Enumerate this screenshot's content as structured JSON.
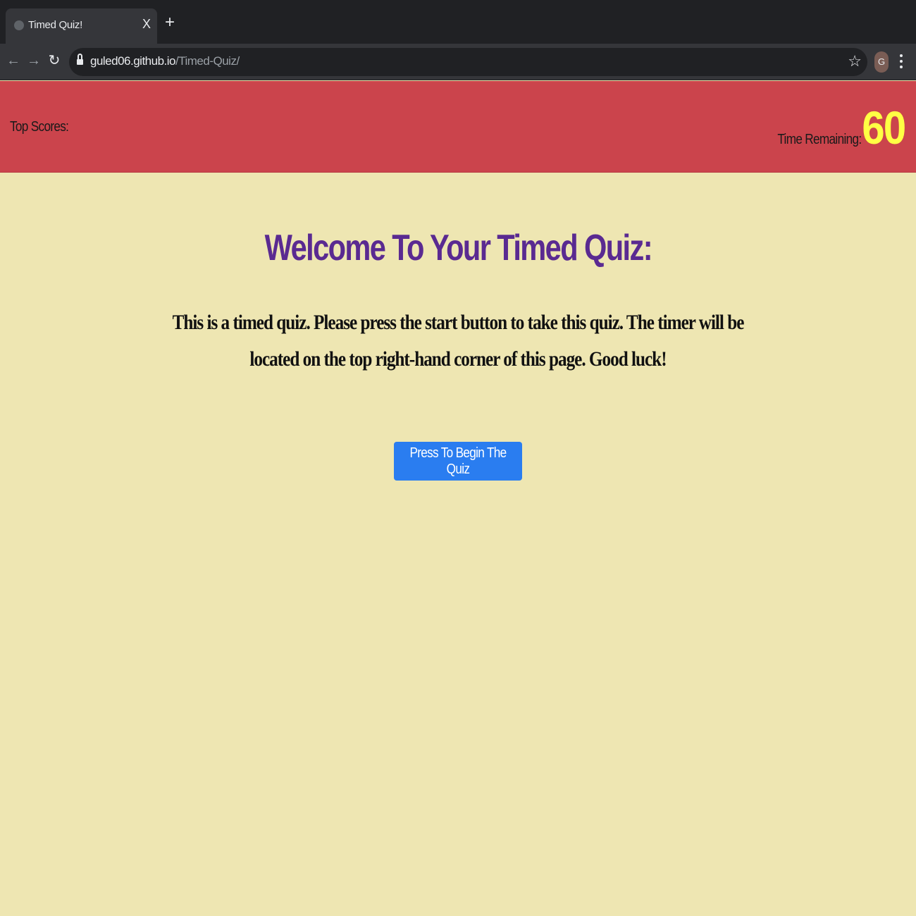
{
  "browser": {
    "tab_title": "Timed Quiz!",
    "tab_close": "X",
    "new_tab": "+",
    "url_host": "guled06.github.io",
    "url_path": "/Timed-Quiz/",
    "avatar_letter": "G",
    "icons": [
      "back-icon",
      "forward-icon",
      "reload-icon",
      "lock-icon",
      "star-icon",
      "menu-icon"
    ]
  },
  "header": {
    "top_scores_label": "Top Scores:",
    "time_label": "Time Remaining:",
    "time_value": "60"
  },
  "main": {
    "title": "Welcome To Your Timed Quiz:",
    "intro": "This is a timed quiz. Please press the start button to take this quiz. The timer will be located on the top right-hand corner of this page. Good luck!",
    "start_button": "Press To Begin The Quiz"
  },
  "colors": {
    "header_bg": "#CB444C",
    "page_bg": "#EEE6B2",
    "title": "#5A2A91",
    "timer": "#FFFF44",
    "button": "#2A7DF0"
  }
}
